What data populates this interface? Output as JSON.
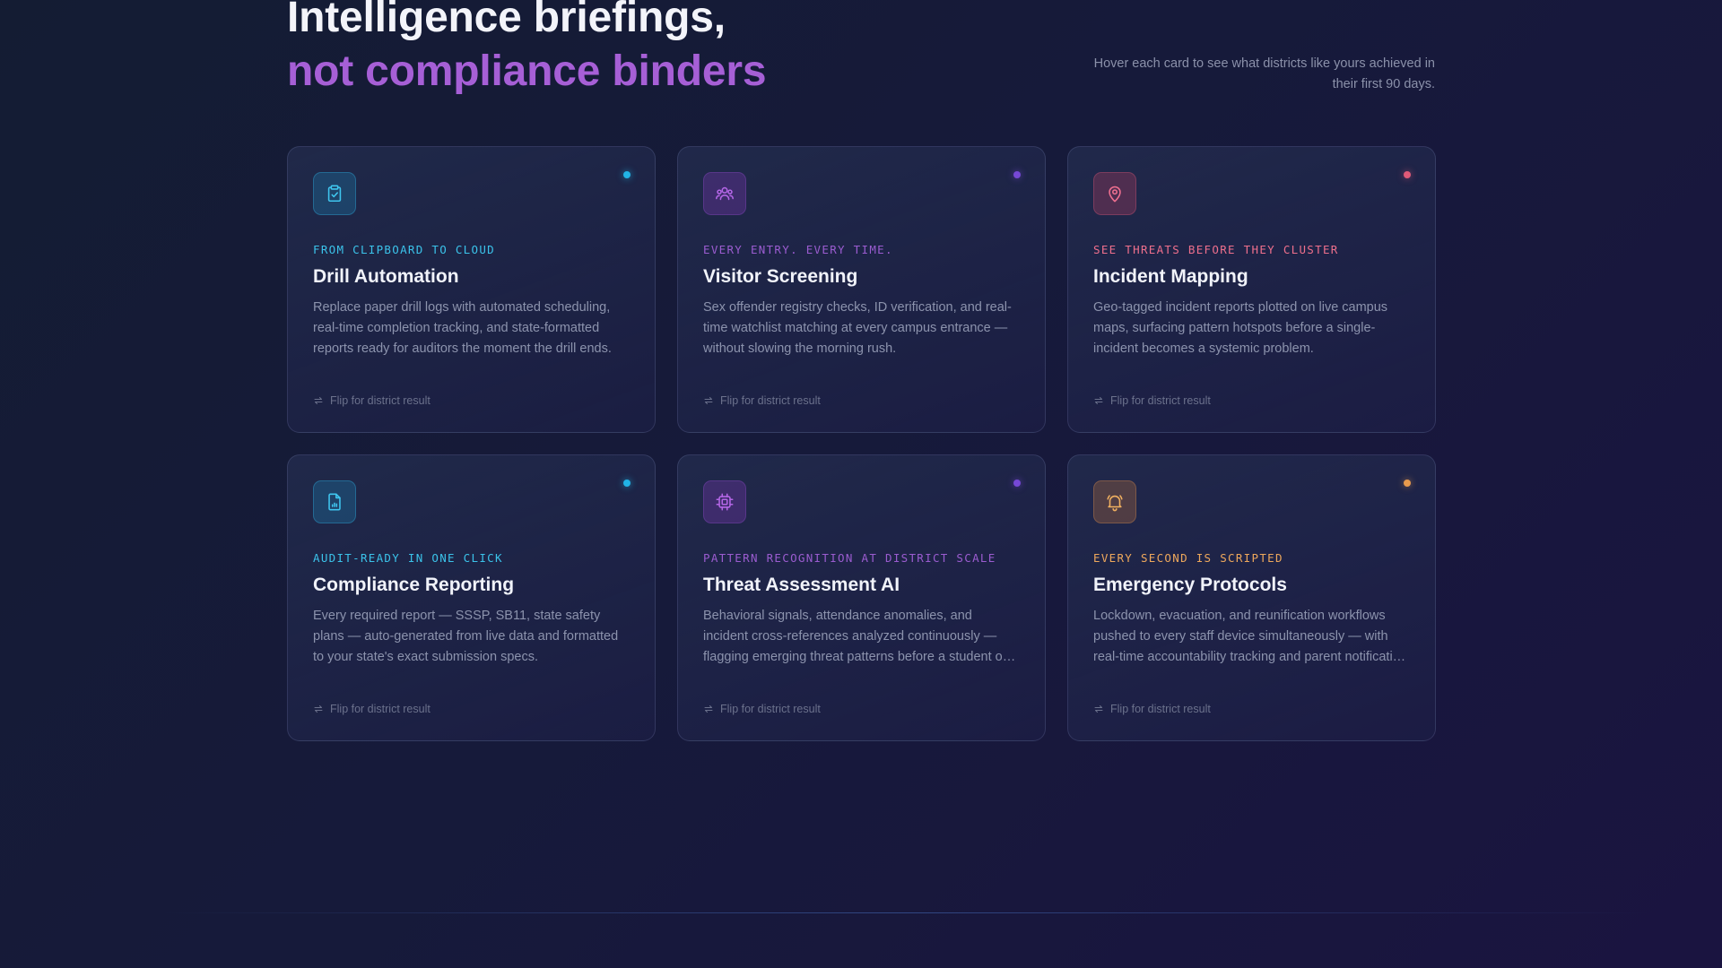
{
  "hero": {
    "title_line1": "Intelligence briefings,",
    "title_line2": "not compliance binders",
    "subtitle": "Hover each card to see what districts like yours achieved in their first 90 days."
  },
  "colors": {
    "teal": "#21b4e6",
    "purple": "#7648d6",
    "rose": "#e05a78",
    "amber": "#e79a4d",
    "headline_accent": "#a65fd6"
  },
  "cards": [
    {
      "accent": "teal",
      "icon": "clipboard-check-icon",
      "eyebrow": "FROM CLIPBOARD TO CLOUD",
      "title": "Drill Automation",
      "description": "Replace paper drill logs with automated scheduling, real-time completion tracking, and state-formatted reports ready for auditors the moment the drill ends.",
      "flip_label": "Flip for district result"
    },
    {
      "accent": "purple",
      "icon": "users-icon",
      "eyebrow": "EVERY ENTRY. EVERY TIME.",
      "title": "Visitor Screening",
      "description": "Sex offender registry checks, ID verification, and real-time watchlist matching at every campus entrance — without slowing the morning rush.",
      "flip_label": "Flip for district result"
    },
    {
      "accent": "rose",
      "icon": "map-pin-icon",
      "eyebrow": "SEE THREATS BEFORE THEY CLUSTER",
      "title": "Incident Mapping",
      "description": "Geo-tagged incident reports plotted on live campus maps, surfacing pattern hotspots before a single-incident becomes a systemic problem.",
      "flip_label": "Flip for district result"
    },
    {
      "accent": "teal",
      "icon": "file-chart-icon",
      "eyebrow": "AUDIT-READY IN ONE CLICK",
      "title": "Compliance Reporting",
      "description": "Every required report — SSSP, SB11, state safety plans — auto-generated from live data and formatted to your state's exact submission specs.",
      "flip_label": "Flip for district result"
    },
    {
      "accent": "purple",
      "icon": "cpu-chip-icon",
      "eyebrow": "PATTERN RECOGNITION AT DISTRICT SCALE",
      "title": "Threat Assessment AI",
      "description": "Behavioral signals, attendance anomalies, and incident cross-references analyzed continuously — flagging emerging threat patterns before a student or staff…",
      "flip_label": "Flip for district result"
    },
    {
      "accent": "amber",
      "icon": "bell-icon",
      "eyebrow": "EVERY SECOND IS SCRIPTED",
      "title": "Emergency Protocols",
      "description": "Lockdown, evacuation, and reunification workflows pushed to every staff device simultaneously — with real-time accountability tracking and parent notification in…",
      "flip_label": "Flip for district result"
    }
  ]
}
